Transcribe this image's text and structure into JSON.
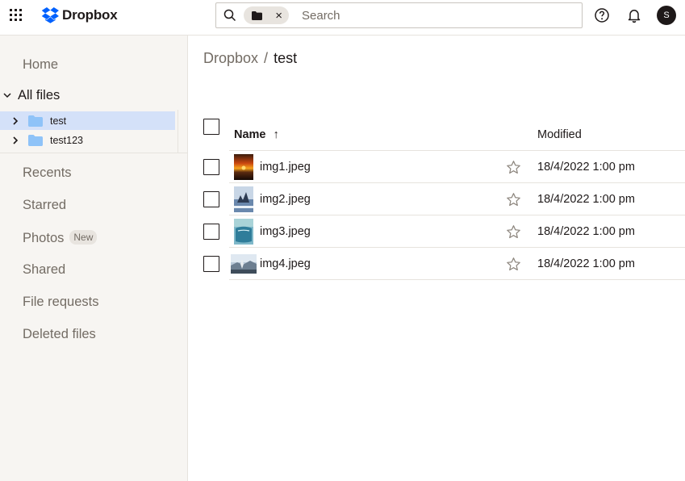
{
  "app": {
    "brand": "Dropbox",
    "accent_color": "#0061fe"
  },
  "search": {
    "placeholder": "Search",
    "chip_icon": "folder-icon",
    "chip_clear": "×"
  },
  "topbar": {
    "help_icon": "help-icon",
    "bell_icon": "bell-icon",
    "avatar_initial": "S"
  },
  "sidebar": {
    "home": "Home",
    "all_files": "All files",
    "tree": [
      {
        "label": "test",
        "selected": true
      },
      {
        "label": "test123",
        "selected": false
      }
    ],
    "items": [
      {
        "label": "Recents"
      },
      {
        "label": "Starred"
      },
      {
        "label": "Photos",
        "badge": "New"
      },
      {
        "label": "Shared"
      },
      {
        "label": "File requests"
      },
      {
        "label": "Deleted files"
      }
    ]
  },
  "breadcrumb": {
    "root": "Dropbox",
    "separator": "/",
    "current": "test"
  },
  "table": {
    "columns": {
      "name": "Name",
      "sort_indicator": "↑",
      "modified": "Modified"
    },
    "rows": [
      {
        "name": "img1.jpeg",
        "modified": "18/4/2022 1:00 pm",
        "thumb": "sunset"
      },
      {
        "name": "img2.jpeg",
        "modified": "18/4/2022 1:00 pm",
        "thumb": "winter"
      },
      {
        "name": "img3.jpeg",
        "modified": "18/4/2022 1:00 pm",
        "thumb": "water"
      },
      {
        "name": "img4.jpeg",
        "modified": "18/4/2022 1:00 pm",
        "thumb": "landscape"
      }
    ]
  }
}
